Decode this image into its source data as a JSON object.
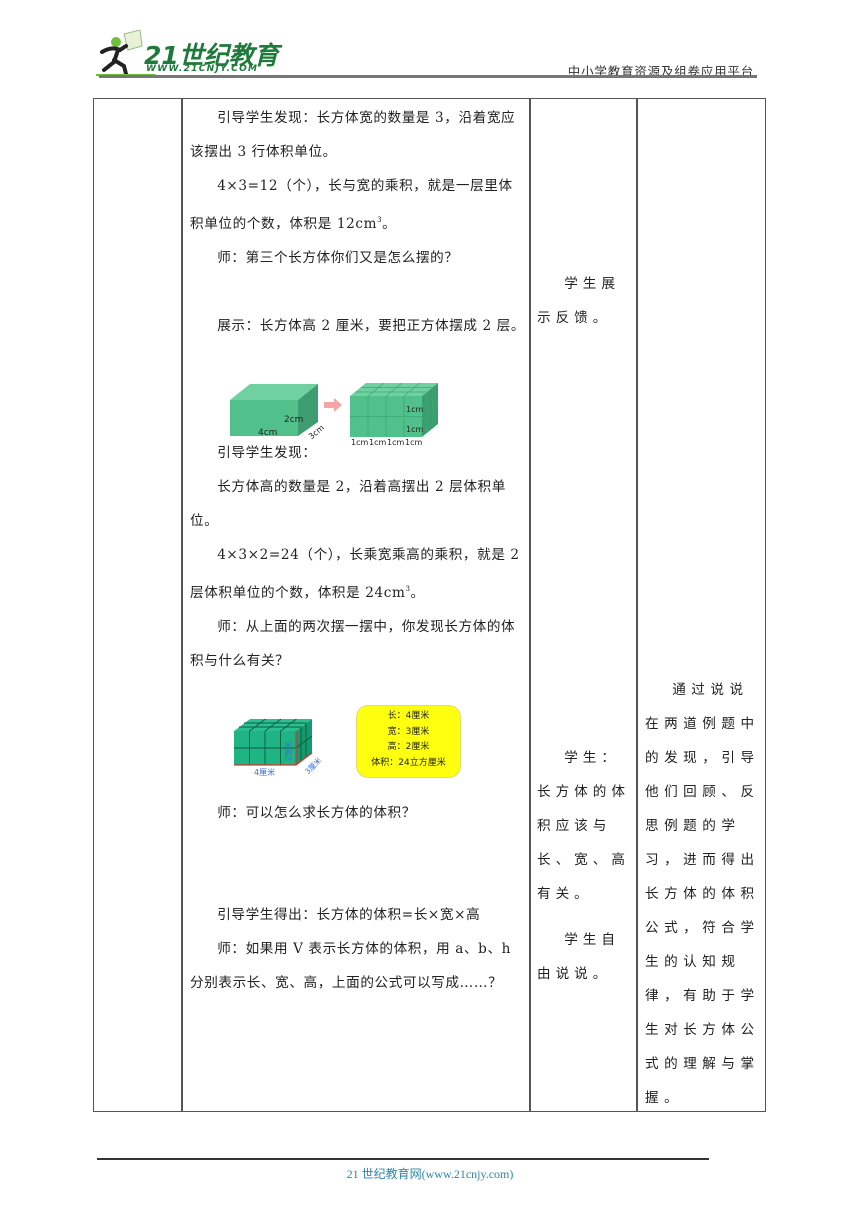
{
  "header": {
    "logo_brand": "21世纪教育",
    "logo_url": "WWW.21CNJY.COM",
    "platform": "中小学教育资源及组卷应用平台"
  },
  "table": {
    "teacher_activity": {
      "p1": "引导学生发现：长方体宽的数量是 3，沿着宽应该摆出 3 行体积单位。",
      "p2_main": "4×3=12（个），长与宽的乘积，就是一层里体积单位的个数，体积是 12cm",
      "p2_sup": "3",
      "p2_end": "。",
      "p3": "师：第三个长方体你们又是怎么摆的？",
      "p4": "展示：长方体高 2 厘米，要把正方体摆成 2 层。",
      "figure1": {
        "left_labels": {
          "length": "4cm",
          "height": "2cm",
          "width": "3cm"
        },
        "right_labels": {
          "unit_height_top": "1cm",
          "unit_height_bottom": "1cm",
          "unit_lengths": [
            "1cm",
            "1cm",
            "1cm",
            "1cm"
          ]
        }
      },
      "p5": "引导学生发现：",
      "p6": "长方体高的数量是 2，沿着高摆出 2 层体积单位。",
      "p7_main": "4×3×2=24（个），长乘宽乘高的乘积，就是 2 层体积单位的个数，体积是 24cm",
      "p7_sup": "3",
      "p7_end": "。",
      "p8": "师：从上面的两次摆一摆中，你发现长方体的体积与什么有关？",
      "figure2": {
        "labels": {
          "length": "4厘米",
          "height": "2厘米",
          "width": "3厘米"
        },
        "info": [
          "长：4厘米",
          "宽：3厘米",
          "高：2厘米",
          "体积：24立方厘米"
        ]
      },
      "p9": "师：可以怎么求长方体的体积？",
      "p10": "引导学生得出：长方体的体积=长×宽×高",
      "p11": "师：如果用 V 表示长方体的体积，用 a、b、h 分别表示长、宽、高，上面的公式可以写成……？"
    },
    "student_activity": {
      "s1": "学生展示反馈。",
      "s2": "学生：长方体的体积应该与长、宽、高有关。",
      "s3": "学生自由说说。"
    },
    "design_intent": {
      "text": "通过说说在两道例题中的发现，引导他们回顾、反思例题的学习，进而得出长方体的体积公式，符合学生的认知规律，有助于学生对长方体公式的理解与掌握。"
    }
  },
  "footer": {
    "text": "21 世纪教育网(www.21cnjy.com)"
  },
  "colors": {
    "brand_green": "#1e7a3a",
    "cube_green": "#4fc08d",
    "cube2_green": "#1fb483",
    "info_yellow": "#ffff10",
    "footer_link": "#2d86a6"
  }
}
